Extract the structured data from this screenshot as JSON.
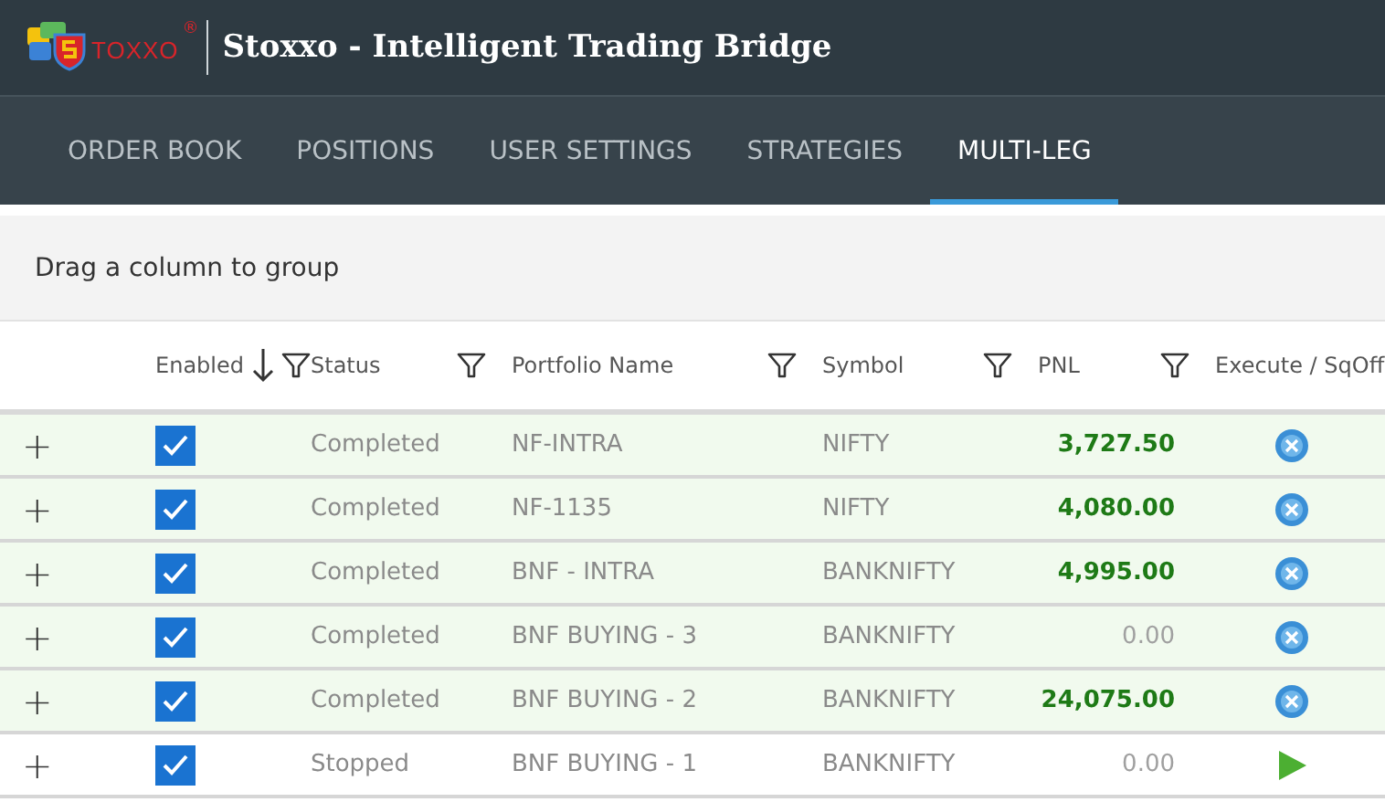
{
  "header": {
    "logo_text": "TOXXO",
    "logo_mark": "®",
    "title": "Stoxxo - Intelligent Trading Bridge"
  },
  "tabs": [
    {
      "label": "ORDER BOOK",
      "selected": false
    },
    {
      "label": "POSITIONS",
      "selected": false
    },
    {
      "label": "USER SETTINGS",
      "selected": false
    },
    {
      "label": "STRATEGIES",
      "selected": false
    },
    {
      "label": "MULTI-LEG",
      "selected": true
    }
  ],
  "group_panel": {
    "hint": "Drag a column to group"
  },
  "table": {
    "columns": [
      {
        "label": "Enabled",
        "sorted_descending": true,
        "filter": true
      },
      {
        "label": "Status",
        "sorted_descending": false,
        "filter": true
      },
      {
        "label": "Portfolio Name",
        "sorted_descending": false,
        "filter": true
      },
      {
        "label": "Symbol",
        "sorted_descending": false,
        "filter": true
      },
      {
        "label": "PNL",
        "sorted_descending": false,
        "filter": true
      },
      {
        "label": "Execute / SqOff",
        "sorted_descending": false,
        "filter": false
      }
    ],
    "rows": [
      {
        "expander": "+",
        "checked": true,
        "highlighted": true,
        "status": "Completed",
        "portfolio": "NF-INTRA",
        "symbol": "NIFTY",
        "pnl": "3,727.50",
        "profit": true,
        "sqoff_available": true
      },
      {
        "expander": "+",
        "checked": true,
        "highlighted": true,
        "status": "Completed",
        "portfolio": "NF-1135",
        "symbol": "NIFTY",
        "pnl": "4,080.00",
        "profit": true,
        "sqoff_available": true
      },
      {
        "expander": "+",
        "checked": true,
        "highlighted": true,
        "status": "Completed",
        "portfolio": "BNF - INTRA",
        "symbol": "BANKNIFTY",
        "pnl": "4,995.00",
        "profit": true,
        "sqoff_available": true
      },
      {
        "expander": "+",
        "checked": true,
        "highlighted": true,
        "status": "Completed",
        "portfolio": "BNF BUYING - 3",
        "symbol": "BANKNIFTY",
        "pnl": "0.00",
        "profit": false,
        "sqoff_available": true
      },
      {
        "expander": "+",
        "checked": true,
        "highlighted": true,
        "status": "Completed",
        "portfolio": "BNF BUYING - 2",
        "symbol": "BANKNIFTY",
        "pnl": "24,075.00",
        "profit": true,
        "sqoff_available": true
      },
      {
        "expander": "+",
        "checked": true,
        "highlighted": false,
        "status": "Stopped",
        "portfolio": "BNF BUYING - 1",
        "symbol": "BANKNIFTY",
        "pnl": "0.00",
        "profit": false,
        "sqoff_available": false
      }
    ]
  }
}
